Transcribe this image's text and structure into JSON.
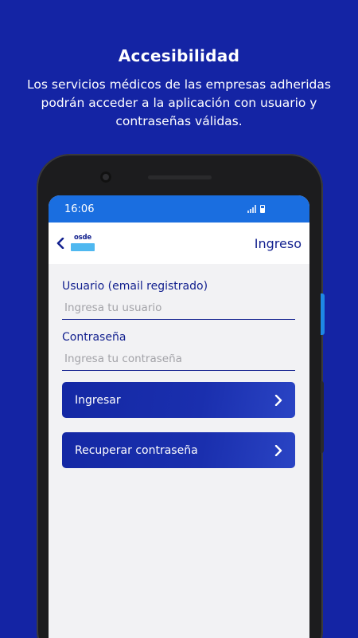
{
  "promo": {
    "title": "Accesibilidad",
    "text": "Los servicios médicos de las empresas adheridas podrán acceder a la aplicación con usuario y contraseñas válidas."
  },
  "status_bar": {
    "time": "16:06",
    "color": "#1a6ee0"
  },
  "header": {
    "logo_text": "osde",
    "title": "Ingreso",
    "back_icon": "chevron-left-icon"
  },
  "form": {
    "username": {
      "label": "Usuario (email registrado)",
      "placeholder": "Ingresa tu usuario",
      "value": ""
    },
    "password": {
      "label": "Contraseña",
      "placeholder": "Ingresa tu contraseña",
      "value": ""
    }
  },
  "buttons": {
    "login": {
      "label": "Ingresar",
      "icon": "chevron-right-icon"
    },
    "recover": {
      "label": "Recuperar contraseña",
      "icon": "chevron-right-icon"
    }
  },
  "colors": {
    "background": "#1424a4",
    "brand": "#13218f",
    "accent": "#4fb8f0"
  }
}
